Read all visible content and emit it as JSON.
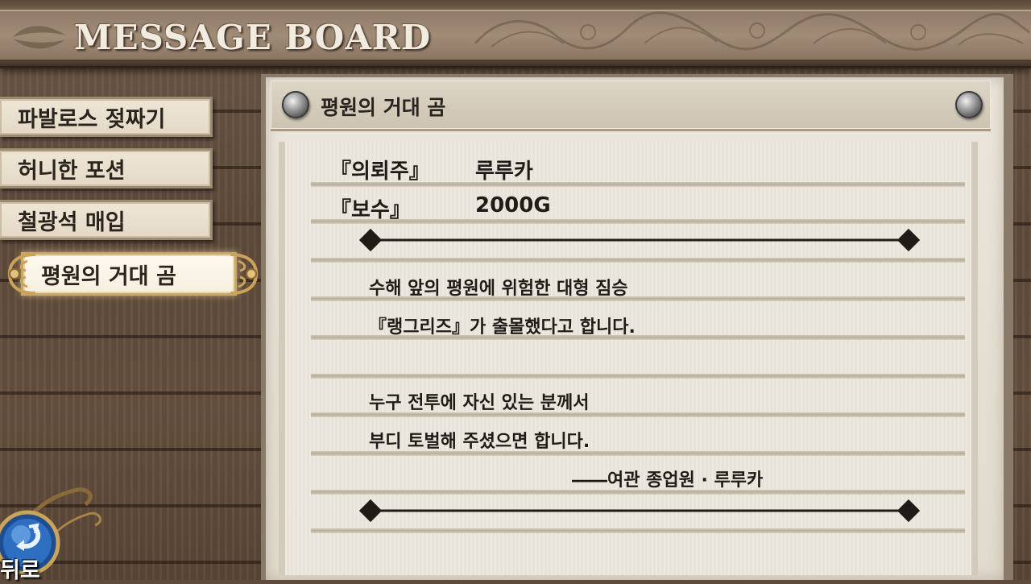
{
  "header": {
    "title": "MESSAGE  BOARD"
  },
  "menu": {
    "items": [
      {
        "label": "파발로스 젖짜기",
        "selected": false
      },
      {
        "label": "허니한 포션",
        "selected": false
      },
      {
        "label": "철광석 매입",
        "selected": false
      },
      {
        "label": "평원의 거대 곰",
        "selected": true
      }
    ]
  },
  "back_button": {
    "label": "뒤로",
    "icon": "return-arrow-icon"
  },
  "board": {
    "title": "평원의 거대 곰",
    "client_label": "『의뢰주』",
    "client_value": "루루카",
    "reward_label": "『보수』",
    "reward_value": "2000G",
    "body": [
      "수해 앞의 평원에 위험한 대형 짐승",
      "『랭그리즈』가 출몰했다고 합니다.",
      "",
      "누구 전투에 자신 있는 분께서",
      "부디 토벌해 주셨으면 합니다."
    ],
    "signature": "――여관 종업원 · 루루카"
  },
  "colors": {
    "wood": "#5f4b3b",
    "paper": "#ece7dd",
    "text": "#1f1b17",
    "header_text": "#f2ebe0",
    "selected_frame": "#c8a868"
  }
}
